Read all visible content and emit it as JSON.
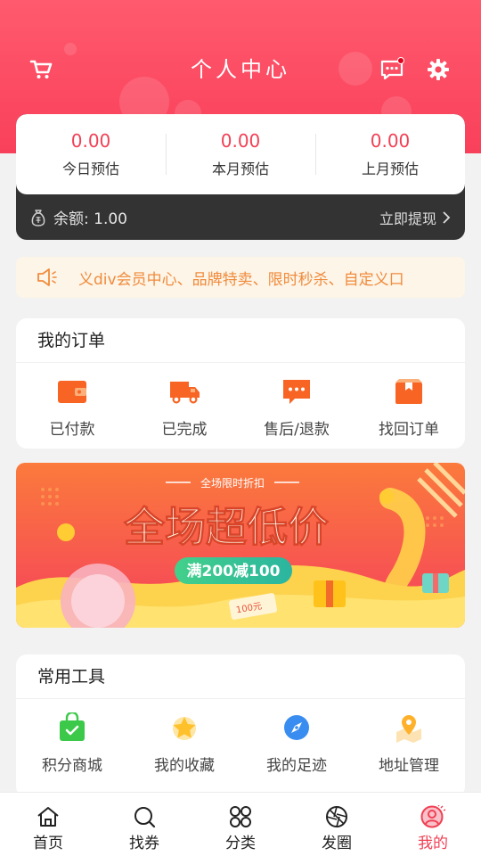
{
  "header": {
    "title": "个人中心",
    "cart_icon": "cart-icon",
    "message_icon": "message-icon",
    "settings_icon": "gear-icon",
    "has_unread": true
  },
  "earnings": [
    {
      "value": "0.00",
      "label": "今日预估"
    },
    {
      "value": "0.00",
      "label": "本月预估"
    },
    {
      "value": "0.00",
      "label": "上月预估"
    }
  ],
  "balance": {
    "text": "余额: 1.00",
    "withdraw_label": "立即提现"
  },
  "notice": {
    "text": "义div会员中心、品牌特卖、限时秒杀、自定义口"
  },
  "orders": {
    "title": "我的订单",
    "items": [
      {
        "label": "已付款",
        "icon": "wallet-icon"
      },
      {
        "label": "已完成",
        "icon": "truck-icon"
      },
      {
        "label": "售后/退款",
        "icon": "chat-dots-icon"
      },
      {
        "label": "找回订单",
        "icon": "box-icon"
      }
    ]
  },
  "banner": {
    "top_text": "全场限时折扣",
    "headline": "全场超低价",
    "pill": "满200减100",
    "tag": "100元"
  },
  "tools": {
    "title": "常用工具",
    "items": [
      {
        "label": "积分商城",
        "icon": "shopping-bag-icon"
      },
      {
        "label": "我的收藏",
        "icon": "star-icon"
      },
      {
        "label": "我的足迹",
        "icon": "compass-icon"
      },
      {
        "label": "地址管理",
        "icon": "map-pin-icon"
      }
    ]
  },
  "tabbar": {
    "active_index": 4,
    "items": [
      {
        "label": "首页",
        "icon": "home-icon"
      },
      {
        "label": "找券",
        "icon": "search-icon"
      },
      {
        "label": "分类",
        "icon": "grid-icon"
      },
      {
        "label": "发圈",
        "icon": "aperture-icon"
      },
      {
        "label": "我的",
        "icon": "user-icon"
      }
    ]
  },
  "colors": {
    "brand_red": "#f04155",
    "header_gradient_start": "#ff5a6e",
    "notice_text": "#f08b3c",
    "dark_bar": "#333333"
  }
}
